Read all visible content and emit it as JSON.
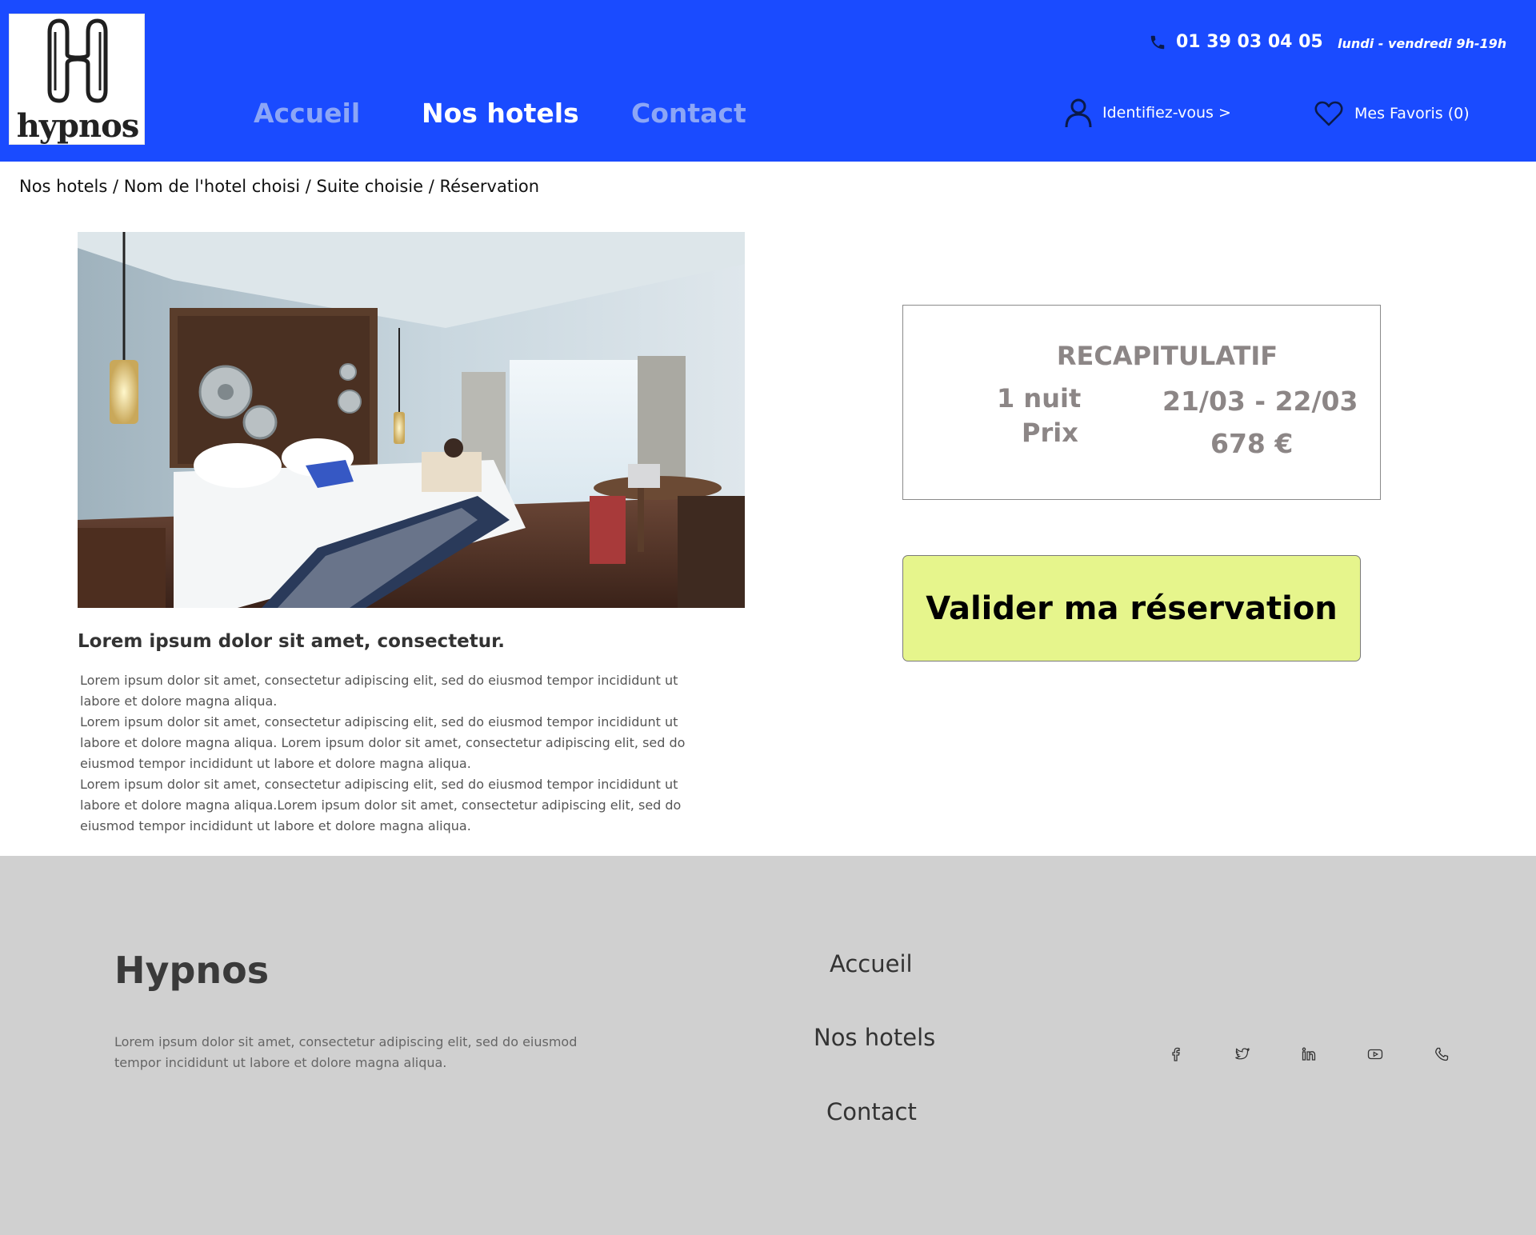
{
  "brand": {
    "logo_text": "hypnos",
    "primary_color": "#1a4bff",
    "accent_button_color": "#e6f58c"
  },
  "header": {
    "phone_icon": "phone-icon",
    "phone": "01 39 03 04 05",
    "hours": "lundi - vendredi 9h-19h",
    "nav": {
      "accueil": "Accueil",
      "hotels": "Nos hotels",
      "contact": "Contact"
    },
    "login_icon": "user-icon",
    "login_label": "Identifiez-vous >",
    "favorites_icon": "heart-icon",
    "favorites_label": "Mes Favoris (0)"
  },
  "breadcrumb": [
    "Nos hotels",
    "Nom de l'hotel choisi",
    "Suite choisie",
    "Réservation"
  ],
  "breadcrumb_separator": " / ",
  "main": {
    "image": "hotel-room-photo",
    "title": "Lorem ipsum dolor sit amet, consectetur.",
    "paragraphs": [
      "Lorem ipsum dolor sit amet, consectetur adipiscing elit, sed do eiusmod tempor incididunt ut labore et dolore magna aliqua.",
      "Lorem ipsum dolor sit amet, consectetur adipiscing elit, sed do eiusmod tempor incididunt ut labore et dolore magna aliqua. Lorem ipsum dolor sit amet, consectetur adipiscing elit, sed do eiusmod tempor incididunt ut labore et dolore magna aliqua.",
      "Lorem ipsum dolor sit amet, consectetur adipiscing elit, sed do eiusmod tempor incididunt ut labore et dolore magna aliqua.Lorem ipsum dolor sit amet, consectetur adipiscing elit, sed do eiusmod tempor incididunt ut labore et dolore magna aliqua."
    ]
  },
  "recap": {
    "title": "RECAPITULATIF",
    "nights": "1 nuit",
    "dates": "21/03 - 22/03",
    "price_label": "Prix",
    "price": "678 €"
  },
  "validate_button": "Valider ma réservation",
  "footer": {
    "brand": "Hypnos",
    "description": "Lorem ipsum dolor sit amet, consectetur adipiscing elit, sed do eiusmod tempor incididunt ut labore et dolore magna aliqua.",
    "links": {
      "accueil": "Accueil",
      "hotels": "Nos hotels",
      "contact": "Contact"
    },
    "socials": [
      "facebook-icon",
      "twitter-icon",
      "linkedin-icon",
      "youtube-icon",
      "phone-icon"
    ]
  }
}
